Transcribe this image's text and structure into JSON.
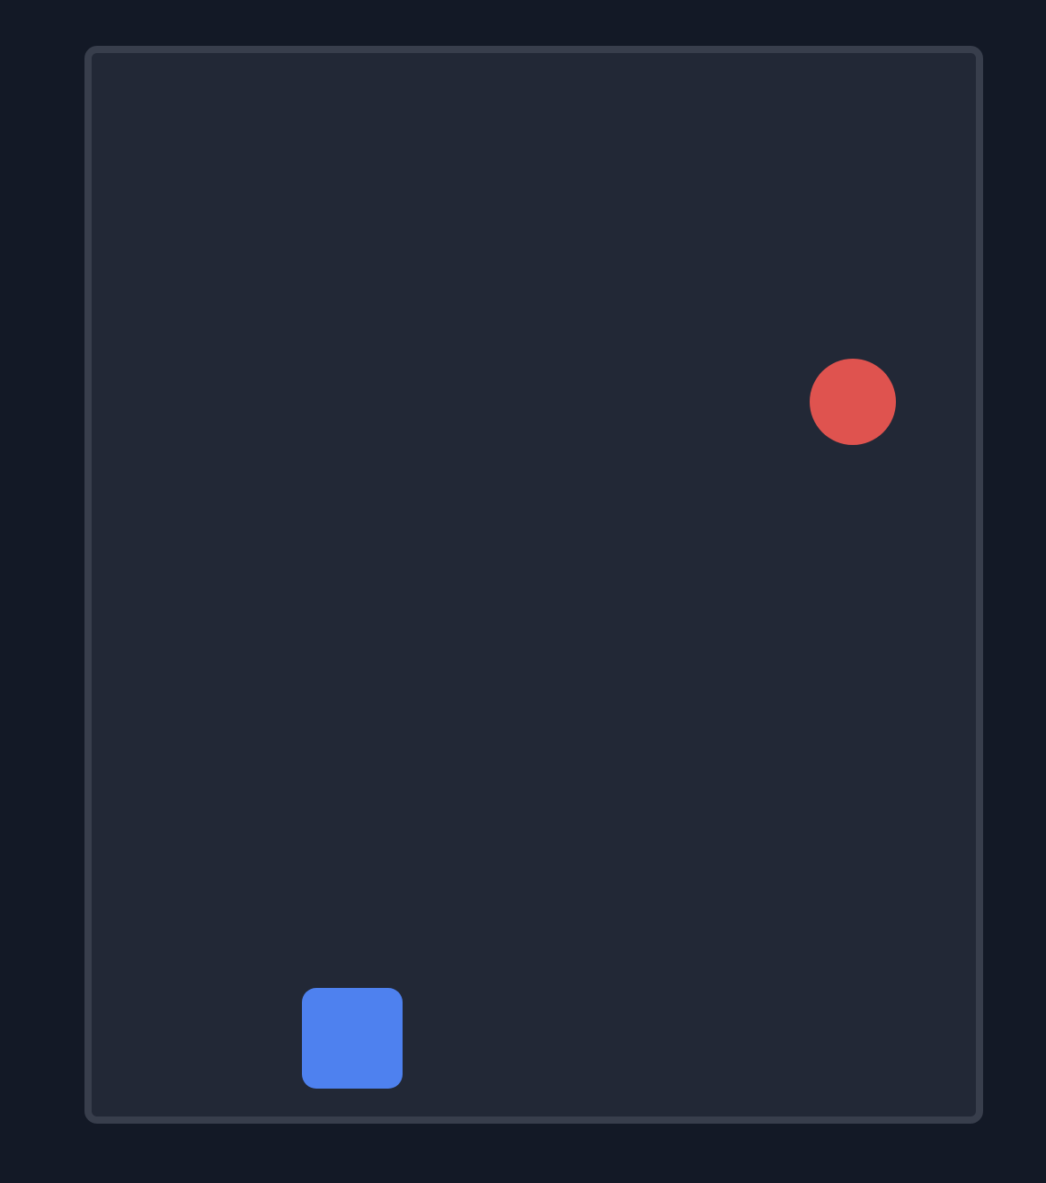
{
  "colors": {
    "page_background": "#131926",
    "arena_background": "#222836",
    "arena_border": "#383e4c",
    "target": "#df534f",
    "player": "#4e81ef"
  },
  "scene": {
    "target": {
      "shape": "circle",
      "color_name": "red"
    },
    "player": {
      "shape": "rounded-square",
      "color_name": "blue"
    }
  }
}
